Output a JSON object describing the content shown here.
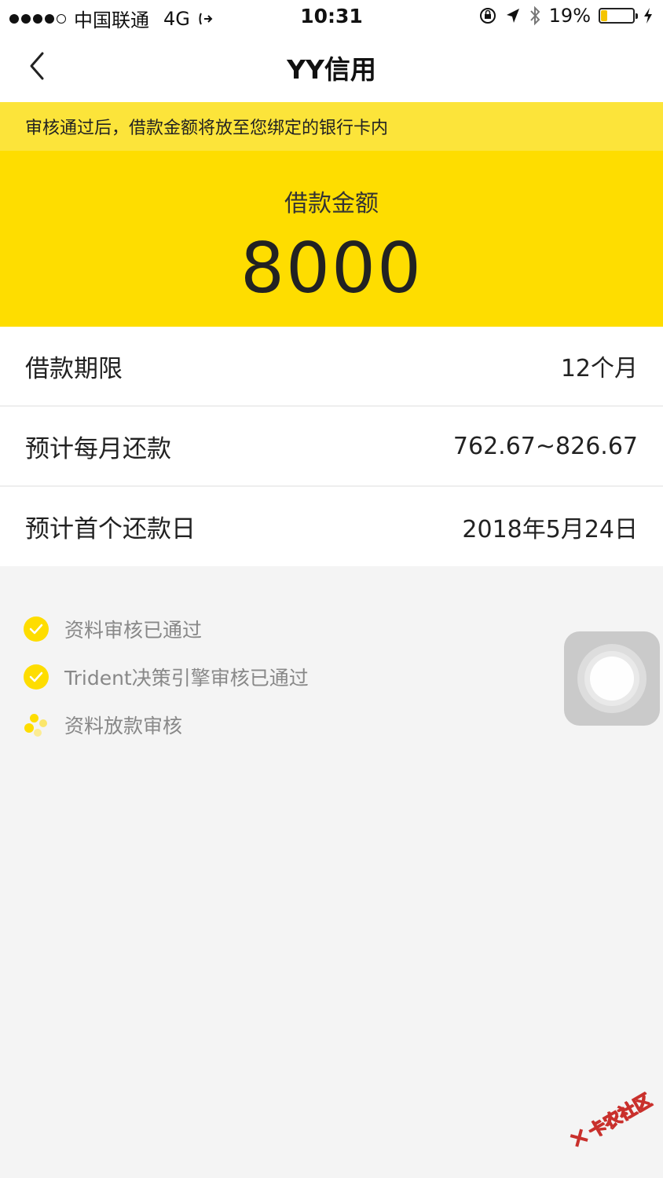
{
  "status_bar": {
    "carrier": "中国联通",
    "network": "4G",
    "time": "10:31",
    "battery_percent": "19%",
    "battery_level": 0.19
  },
  "nav": {
    "title": "YY信用"
  },
  "notice": {
    "text": "审核通过后，借款金额将放至您绑定的银行卡内"
  },
  "loan": {
    "amount_label": "借款金额",
    "amount": "8000"
  },
  "details": [
    {
      "label": "借款期限",
      "value": "12个月"
    },
    {
      "label": "预计每月还款",
      "value": "762.67~826.67"
    },
    {
      "label": "预计首个还款日",
      "value": "2018年5月24日"
    }
  ],
  "steps": [
    {
      "text": "资料审核已通过",
      "status": "done"
    },
    {
      "text": "Trident决策引擎审核已通过",
      "status": "done"
    },
    {
      "text": "资料放款审核",
      "status": "pending"
    }
  ],
  "watermark": {
    "text": "卡农社区"
  },
  "colors": {
    "accent": "#fedd00",
    "notice_bg": "#fce43a",
    "background": "#f4f4f4"
  }
}
